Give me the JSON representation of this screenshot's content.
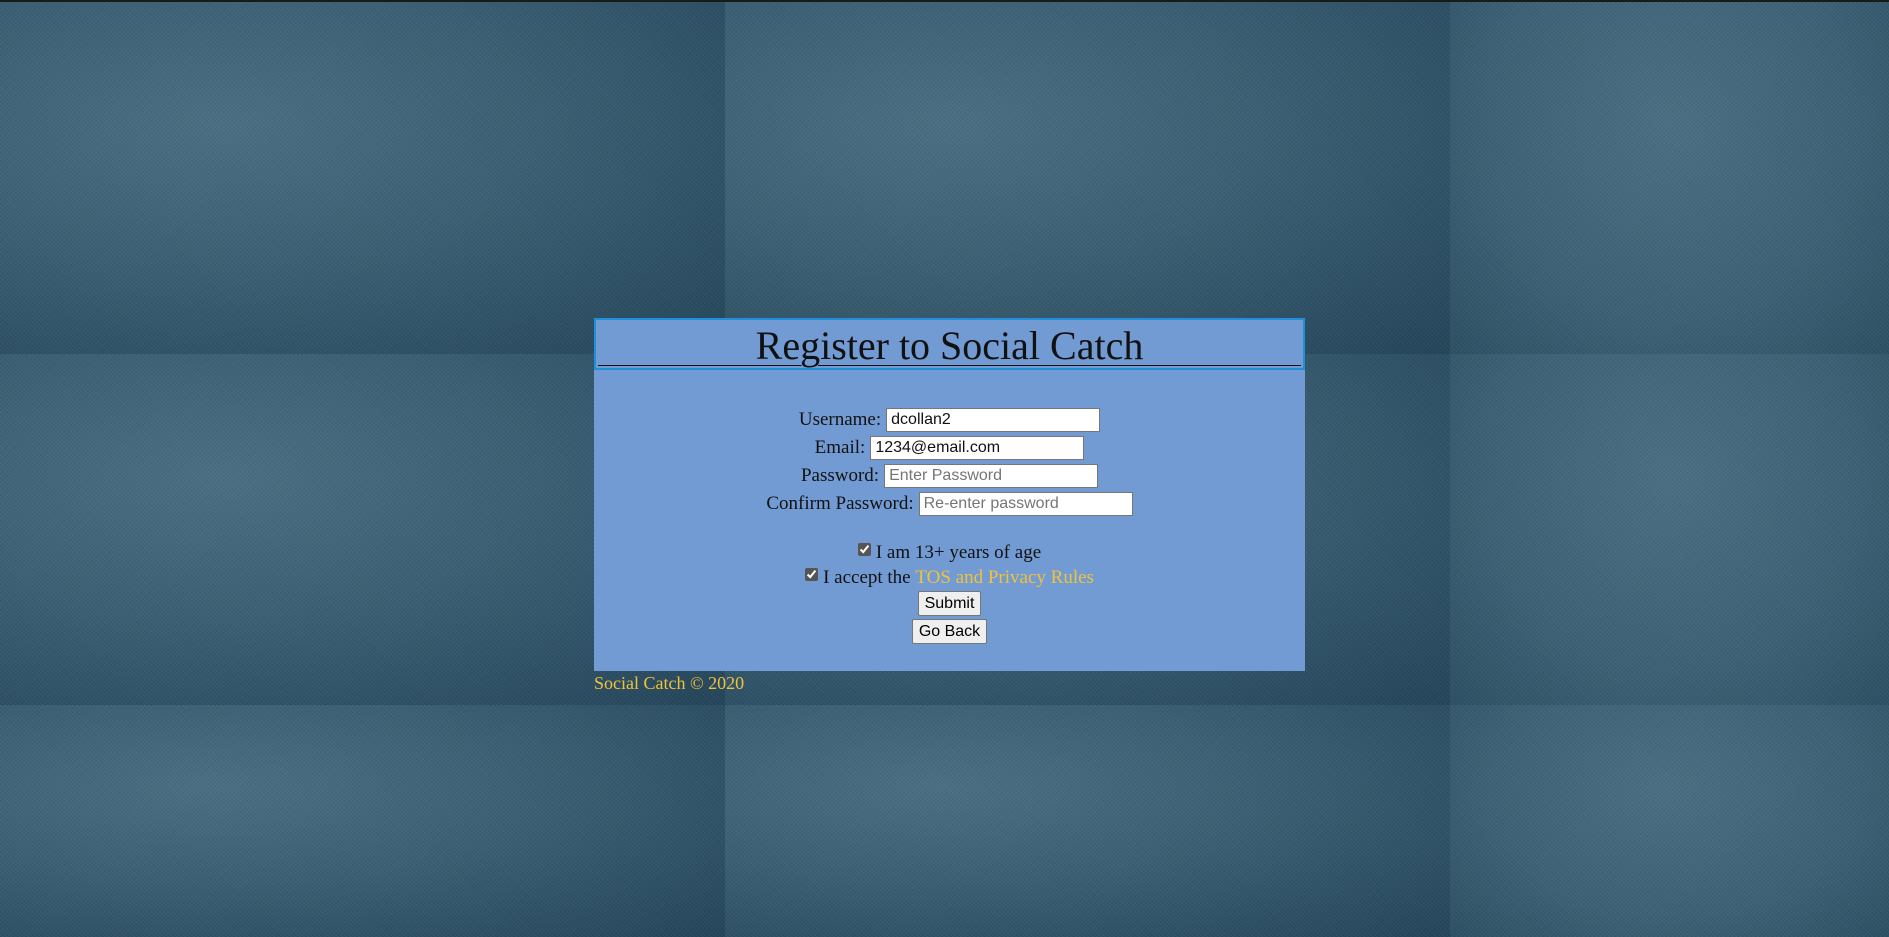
{
  "page": {
    "title": "Register to Social Catch",
    "colors": {
      "panel_bg": "#729bd3",
      "header_border": "#1f8fd8",
      "link": "#f0c23a",
      "footer_text": "#f0c23a",
      "background": "#2f5468"
    }
  },
  "form": {
    "username": {
      "label": "Username:",
      "value": "dcollan2",
      "placeholder": ""
    },
    "email": {
      "label": "Email:",
      "value": "1234@email.com",
      "placeholder": ""
    },
    "password": {
      "label": "Password:",
      "value": "",
      "placeholder": "Enter Password"
    },
    "confirm_password": {
      "label": "Confirm Password:",
      "value": "",
      "placeholder": "Re-enter password"
    },
    "age_check": {
      "label": "I am 13+ years of age",
      "checked": true
    },
    "tos_check": {
      "label_prefix": "I accept the ",
      "link_text": "TOS and Privacy Rules",
      "checked": true
    },
    "submit_label": "Submit",
    "back_label": "Go Back"
  },
  "footer": {
    "text": "Social Catch © 2020"
  }
}
